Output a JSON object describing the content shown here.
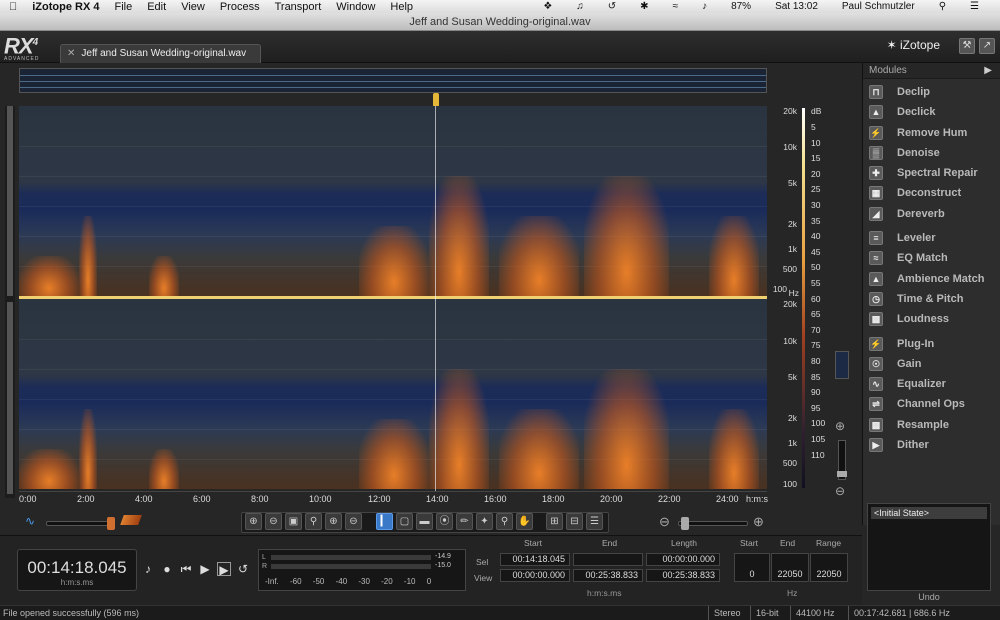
{
  "menubar": {
    "app_name": "iZotope RX 4",
    "items": [
      "File",
      "Edit",
      "View",
      "Process",
      "Transport",
      "Window",
      "Help"
    ],
    "battery": "87%",
    "clock": "Sat 13:02",
    "user": "Paul Schmutzler"
  },
  "window": {
    "title": "Jeff and Susan Wedding-original.wav"
  },
  "header": {
    "logo_main": "RX",
    "logo_version": "4",
    "logo_edition": "ADVANCED",
    "file_tab": "Jeff and Susan Wedding-original.wav",
    "brand": "iZotope"
  },
  "spectrogram": {
    "freq_labels": [
      "20k",
      "10k",
      "5k",
      "2k",
      "1k",
      "500",
      "100"
    ],
    "freq_unit": "Hz",
    "db_unit": "dB",
    "db_labels": [
      "5",
      "10",
      "15",
      "20",
      "25",
      "30",
      "35",
      "40",
      "45",
      "50",
      "55",
      "60",
      "65",
      "70",
      "75",
      "80",
      "85",
      "90",
      "95",
      "100",
      "105",
      "110"
    ],
    "time_labels": [
      "0:00",
      "2:00",
      "4:00",
      "6:00",
      "8:00",
      "10:00",
      "12:00",
      "14:00",
      "16:00",
      "18:00",
      "20:00",
      "22:00",
      "24:00"
    ],
    "time_unit": "h:m:s"
  },
  "modules": {
    "header": "Modules",
    "groups": [
      [
        "Declip",
        "Declick",
        "Remove Hum",
        "Denoise",
        "Spectral Repair",
        "Deconstruct",
        "Dereverb"
      ],
      [
        "Leveler",
        "EQ Match",
        "Ambience Match",
        "Time & Pitch",
        "Loudness"
      ],
      [
        "Plug-In",
        "Gain",
        "Equalizer",
        "Channel Ops",
        "Resample",
        "Dither"
      ]
    ]
  },
  "history": {
    "item": "<Initial State>",
    "footer": "Undo"
  },
  "transport": {
    "time": "00:14:18.045",
    "time_unit": "h:m:s.ms"
  },
  "meter": {
    "left_label": "L",
    "right_label": "R",
    "peak_left": "-14.9",
    "peak_right": "-15.0",
    "scale": "-Inf. -60 -50 -40 -30 -20 -10 0"
  },
  "selection": {
    "headers": [
      "Start",
      "End",
      "Length"
    ],
    "sel_label": "Sel",
    "view_label": "View",
    "sel": [
      "00:14:18.045",
      "",
      "00:00:00.000"
    ],
    "view": [
      "00:00:00.000",
      "00:25:38.833",
      "00:25:38.833"
    ],
    "unit": "h:m:s.ms"
  },
  "hz": {
    "headers": [
      "Start",
      "End",
      "Range"
    ],
    "values": [
      "0",
      "22050",
      "22050"
    ],
    "unit": "Hz"
  },
  "status": {
    "message": "File opened successfully (596 ms)",
    "channels": "Stereo",
    "bits": "16-bit",
    "rate": "44100 Hz",
    "duration": "00:17:42.681 | 686.6 Hz"
  }
}
